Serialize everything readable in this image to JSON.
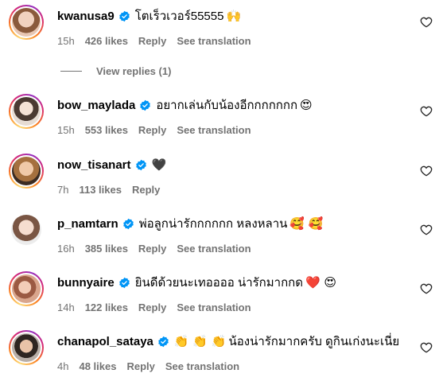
{
  "comments": [
    {
      "username": "kwanusa9",
      "text": "โตเร็วเวอร์55555",
      "emoji": "🙌",
      "time": "15h",
      "likes": "426 likes",
      "reply": "Reply",
      "translate": "See translation",
      "avatar_color": "#c9a38a"
    },
    {
      "username": "bow_maylada",
      "text": "อยากเล่นกับน้องอีกกกกกกก",
      "emoji": "😍",
      "time": "15h",
      "likes": "553 likes",
      "reply": "Reply",
      "translate": "See translation",
      "avatar_color": "#d8cfc4"
    },
    {
      "username": "now_tisanart",
      "text": "",
      "emoji": "🖤",
      "time": "7h",
      "likes": "113 likes",
      "reply": "Reply",
      "translate": "",
      "avatar_color": "#b98f6a"
    },
    {
      "username": "p_namtarn",
      "text": "พ่อลูกน่ารักกกกกก หลงหลาน",
      "emoji": "🥰 🥰",
      "time": "16h",
      "likes": "385 likes",
      "reply": "Reply",
      "translate": "See translation",
      "avatar_color": "#e2c8b8"
    },
    {
      "username": "bunnyaire",
      "text": "ยินดีด้วยนะเทออออ น่ารักมากกด",
      "emoji": "❤️ 😍",
      "time": "14h",
      "likes": "122 likes",
      "reply": "Reply",
      "translate": "See translation",
      "avatar_color": "#c28f78"
    },
    {
      "username": "chanapol_sataya",
      "text": "น้องน่ารักมากครับ ดูกินเก่งนะเนี่ย",
      "emoji_prefix": "👏 👏 👏",
      "time": "4h",
      "likes": "48 likes",
      "reply": "Reply",
      "translate": "See translation",
      "avatar_color": "#8a7f78"
    }
  ],
  "view_replies": "View replies (1)",
  "colors": {
    "verified": "#0095f6",
    "meta": "#737373"
  },
  "icons": {
    "like": "heart-outline-icon",
    "verified": "verified-badge-icon"
  }
}
